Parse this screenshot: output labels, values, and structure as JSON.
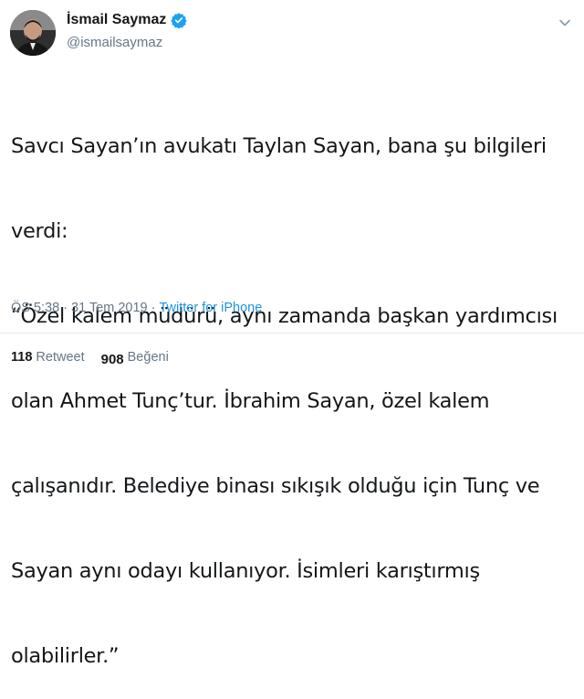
{
  "author": {
    "display_name": "İsmail Saymaz",
    "handle": "@ismailsaymaz",
    "verified": true
  },
  "tweet": {
    "lines": [
      "Savcı Sayan’ın avukatı Taylan Sayan, bana şu bilgileri",
      "verdi:",
      "“Özel kalem müdürü, aynı zamanda başkan yardımcısı",
      "olan Ahmet Tunç’tur. İbrahim Sayan, özel kalem",
      "çalışanıdır. Belediye binası sıkışık olduğu için Tunç ve",
      "Sayan aynı odayı kullanıyor. İsimleri karıştırmış",
      "olabilirler.”"
    ],
    "time": "ÖS 5:38",
    "separator": "·",
    "date": "31 Tem 2019",
    "source": "Twitter for iPhone"
  },
  "stats": {
    "retweet_count": "118",
    "retweet_label": "Retweet",
    "like_count": "908",
    "like_label": "Beğeni"
  },
  "colors": {
    "link": "#1b95e0",
    "muted": "#657786",
    "verified": "#1da1f2"
  },
  "icons": {
    "verified": "verified-badge-icon",
    "menu": "chevron-down-icon"
  }
}
